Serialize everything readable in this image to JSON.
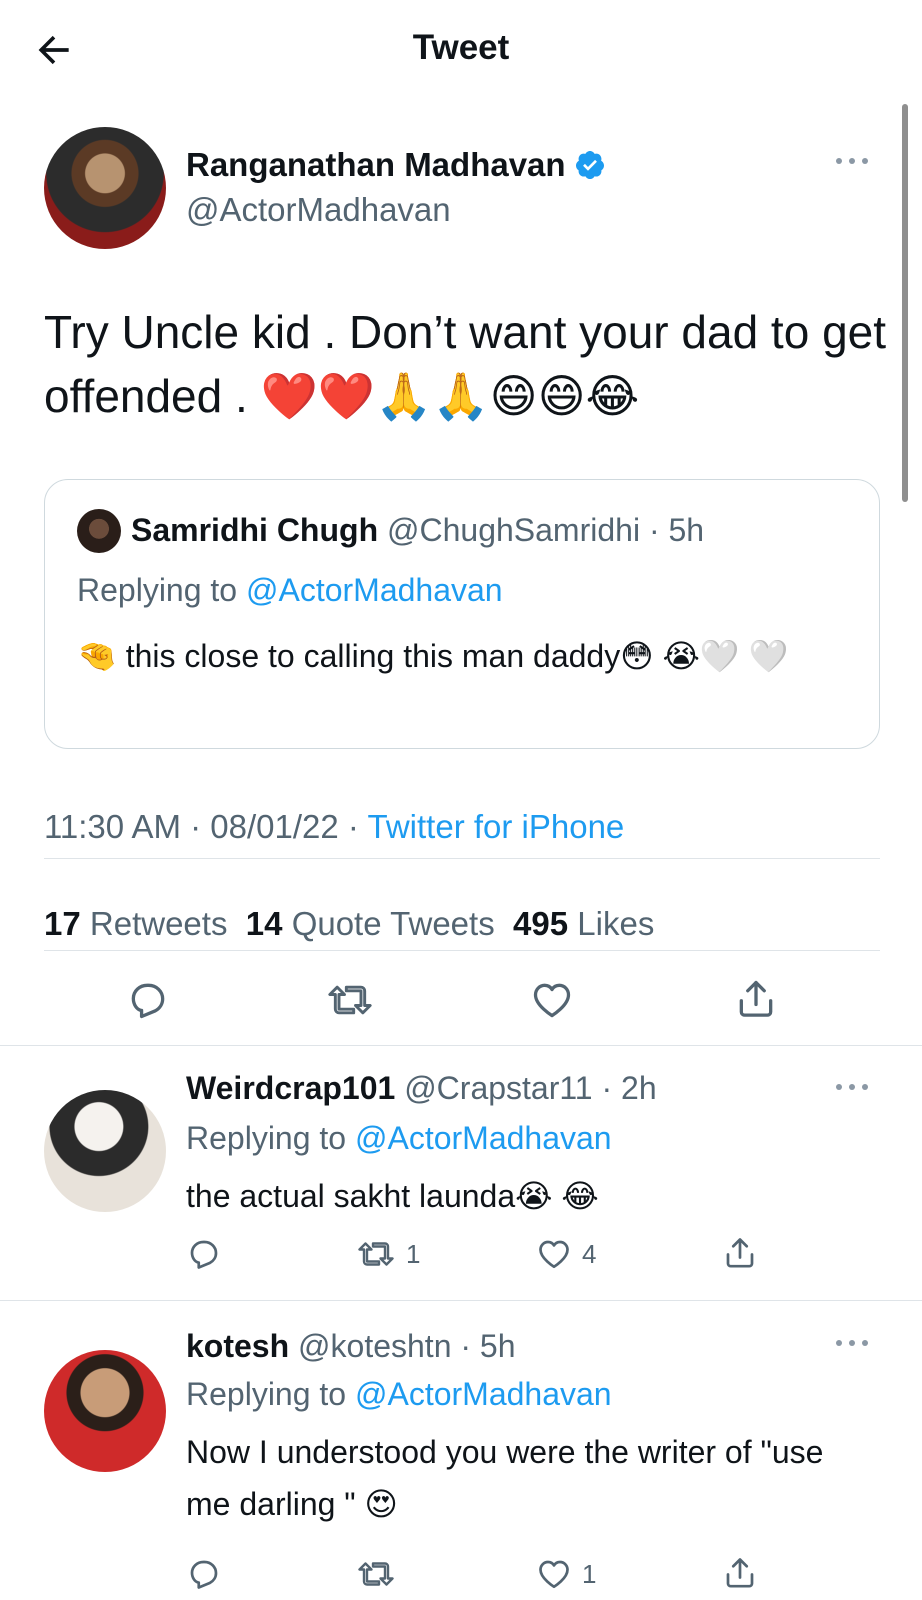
{
  "header": {
    "title": "Tweet"
  },
  "tweet": {
    "author_name": "Ranganathan Madhavan",
    "author_handle": "@ActorMadhavan",
    "text": "Try Uncle kid . Don’t want your dad to get offended . ❤️❤️🙏🙏😄😄😂",
    "timestamp": "11:30 AM · 08/01/22 · ",
    "source": "Twitter for iPhone",
    "stats": {
      "retweets_count": "17",
      "retweets_label": "Retweets",
      "quotes_count": "14",
      "quotes_label": "Quote Tweets",
      "likes_count": "495",
      "likes_label": "Likes"
    }
  },
  "quoted": {
    "author_name": "Samridhi Chugh",
    "author_handle_time": "@ChughSamridhi · 5h",
    "replying_prefix": "Replying to ",
    "replying_handle": "@ActorMadhavan",
    "text": "🤏 this close to calling this man daddy😳 😭🤍 🤍"
  },
  "replies": [
    {
      "name": "Weirdcrap101",
      "handle_time": "@Crapstar11 · 2h",
      "replying_prefix": "Replying to ",
      "replying_handle": "@ActorMadhavan",
      "text": "the actual sakht launda😭 😂",
      "retweets": "1",
      "likes": "4"
    },
    {
      "name": "kotesh",
      "handle_time": "@koteshtn · 5h",
      "replying_prefix": "Replying to ",
      "replying_handle": "@ActorMadhavan",
      "text": "Now I understood you were the writer of \"use me darling \" 😍",
      "retweets": "",
      "likes": "1"
    }
  ],
  "icons": {
    "back": "arrow-left-icon",
    "verified": "verified-badge-icon",
    "more": "more-horizontal-icon",
    "reply": "reply-icon",
    "retweet": "retweet-icon",
    "like": "heart-icon",
    "share": "share-icon"
  },
  "colors": {
    "accent": "#1d9bf0",
    "muted": "#536471",
    "text": "#0f1419",
    "border": "#cfd9de"
  }
}
